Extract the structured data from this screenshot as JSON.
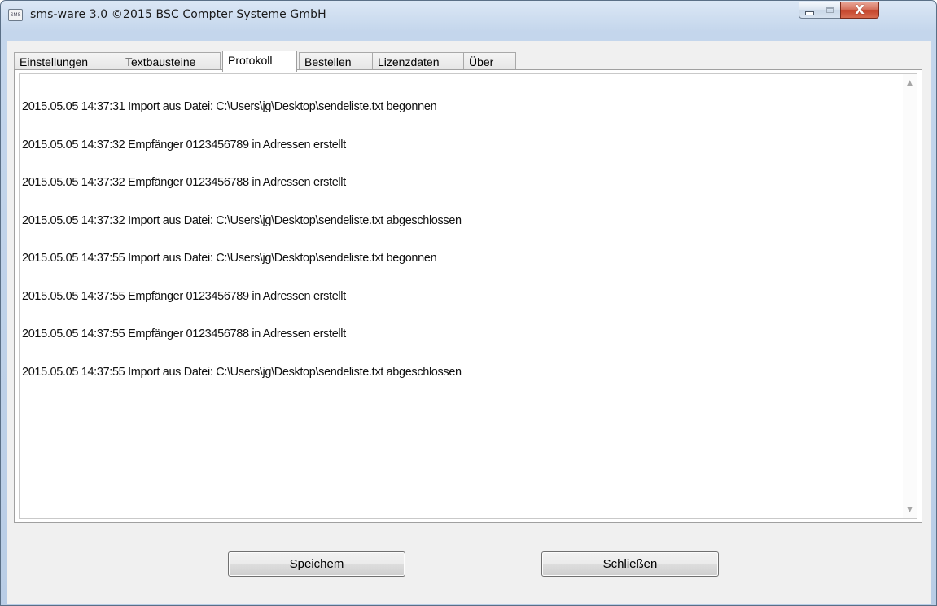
{
  "window": {
    "title": "sms-ware 3.0 ©2015 BSC Compter Systeme GmbH",
    "icon_label": "SMS",
    "icon": "sms-app-icon",
    "controls": [
      "minimize-icon",
      "maximize-icon",
      "close-icon"
    ],
    "close_glyph": "X"
  },
  "tabs": [
    {
      "label": "Einstellungen",
      "active": false
    },
    {
      "label": "Textbausteine",
      "active": false
    },
    {
      "label": "Protokoll",
      "active": true
    },
    {
      "label": "Bestellen",
      "active": false
    },
    {
      "label": "Lizenzdaten",
      "active": false
    },
    {
      "label": "Über",
      "active": false
    }
  ],
  "log": {
    "lines": [
      "2015.05.05 14:37:31 Import aus Datei: C:\\Users\\jg\\Desktop\\sendeliste.txt begonnen",
      "2015.05.05 14:37:32 Empfänger 0123456789 in Adressen erstellt",
      "2015.05.05 14:37:32 Empfänger 0123456788 in Adressen erstellt",
      "2015.05.05 14:37:32 Import aus Datei: C:\\Users\\jg\\Desktop\\sendeliste.txt abgeschlossen",
      "2015.05.05 14:37:55 Import aus Datei: C:\\Users\\jg\\Desktop\\sendeliste.txt begonnen",
      "2015.05.05 14:37:55 Empfänger 0123456789 in Adressen erstellt",
      "2015.05.05 14:37:55 Empfänger 0123456788 in Adressen erstellt",
      "2015.05.05 14:37:55 Import aus Datei: C:\\Users\\jg\\Desktop\\sendeliste.txt abgeschlossen"
    ],
    "scroll_up_glyph": "▲",
    "scroll_down_glyph": "▼"
  },
  "buttons": {
    "save_label": "Speichem",
    "close_label": "Schließen"
  },
  "colors": {
    "window_frame": "#c4d6ec",
    "client_background": "#f0f0f0",
    "close_button": "#c4432b"
  }
}
